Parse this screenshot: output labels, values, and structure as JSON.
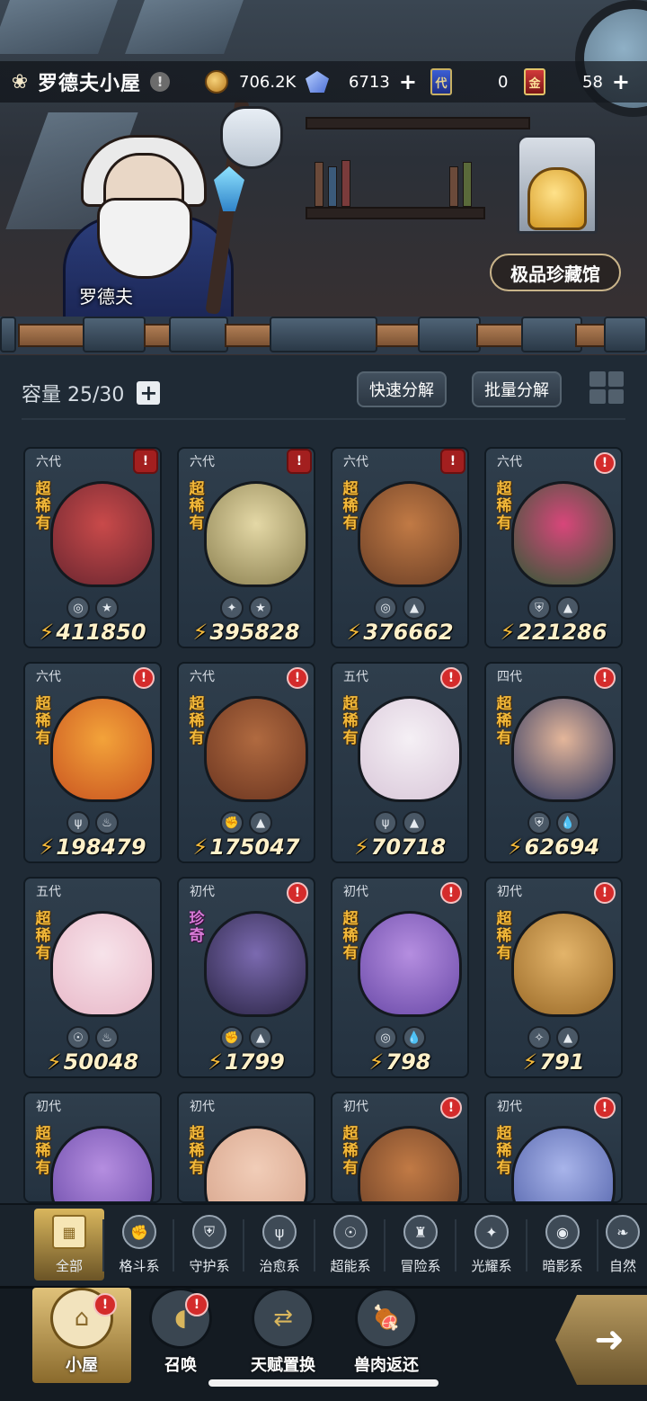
{
  "header": {
    "title": "罗德夫小屋",
    "info_icon": "info-icon"
  },
  "resources": {
    "gold": {
      "value": "706.2K",
      "icon": "gold-coin-icon"
    },
    "crystal": {
      "value": "6713",
      "icon": "crystal-icon"
    },
    "blue_ticket": {
      "value": "0",
      "icon": "blue-ticket-icon",
      "glyph": "代"
    },
    "red_ticket": {
      "value": "58",
      "icon": "red-ticket-icon",
      "glyph": "金"
    }
  },
  "scene": {
    "npc_name": "罗德夫",
    "vault_button": "极品珍藏馆"
  },
  "bag": {
    "capacity_label": "容量 25/30",
    "quick_decompose": "快速分解",
    "batch_decompose": "批量分解"
  },
  "cards": [
    {
      "gen": "六代",
      "rarity": "超稀有",
      "power": "411850",
      "alert": "boxed",
      "types": [
        "◎",
        "★"
      ],
      "art": [
        "#6a2630",
        "#c94a4a"
      ]
    },
    {
      "gen": "六代",
      "rarity": "超稀有",
      "power": "395828",
      "alert": "boxed",
      "types": [
        "✦",
        "★"
      ],
      "art": [
        "#8b8050",
        "#e4d8a6"
      ]
    },
    {
      "gen": "六代",
      "rarity": "超稀有",
      "power": "376662",
      "alert": "boxed",
      "types": [
        "◎",
        "▲"
      ],
      "art": [
        "#6b3f26",
        "#c17a45"
      ]
    },
    {
      "gen": "六代",
      "rarity": "超稀有",
      "power": "221286",
      "alert": "round",
      "types": [
        "⛨",
        "▲"
      ],
      "art": [
        "#2f5a35",
        "#d8467a"
      ]
    },
    {
      "gen": "六代",
      "rarity": "超稀有",
      "power": "198479",
      "alert": "round",
      "types": [
        "ψ",
        "♨"
      ],
      "art": [
        "#c95420",
        "#f3a33a"
      ]
    },
    {
      "gen": "六代",
      "rarity": "超稀有",
      "power": "175047",
      "alert": "round",
      "types": [
        "✊",
        "▲"
      ],
      "art": [
        "#6b3520",
        "#b06a40"
      ]
    },
    {
      "gen": "五代",
      "rarity": "超稀有",
      "power": "70718",
      "alert": "round",
      "types": [
        "ψ",
        "▲"
      ],
      "art": [
        "#d9c7d9",
        "#f5f0f5"
      ]
    },
    {
      "gen": "四代",
      "rarity": "超稀有",
      "power": "62694",
      "alert": "round",
      "types": [
        "⛨",
        "💧"
      ],
      "art": [
        "#2a3560",
        "#e4b69a"
      ]
    },
    {
      "gen": "五代",
      "rarity": "超稀有",
      "power": "50048",
      "alert": "none",
      "types": [
        "☉",
        "♨"
      ],
      "art": [
        "#e8b8c8",
        "#f7e3ea"
      ]
    },
    {
      "gen": "初代",
      "rarity": "珍奇",
      "power": "1799",
      "alert": "round",
      "types": [
        "✊",
        "▲"
      ],
      "art": [
        "#2b2545",
        "#7b6ab0"
      ]
    },
    {
      "gen": "初代",
      "rarity": "超稀有",
      "power": "798",
      "alert": "round",
      "types": [
        "◎",
        "💧"
      ],
      "art": [
        "#6a4aa8",
        "#b58ee0"
      ]
    },
    {
      "gen": "初代",
      "rarity": "超稀有",
      "power": "791",
      "alert": "round",
      "types": [
        "✧",
        "▲"
      ],
      "art": [
        "#9a6a28",
        "#e3b46a"
      ]
    },
    {
      "gen": "初代",
      "rarity": "超稀有",
      "power": "",
      "alert": "none",
      "types": [],
      "art": [
        "#6a4aa8",
        "#b58ee0"
      ]
    },
    {
      "gen": "初代",
      "rarity": "超稀有",
      "power": "",
      "alert": "none",
      "types": [],
      "art": [
        "#d6a38a",
        "#f1cdb8"
      ]
    },
    {
      "gen": "初代",
      "rarity": "超稀有",
      "power": "",
      "alert": "round",
      "types": [],
      "art": [
        "#6b3f26",
        "#c17a45"
      ]
    },
    {
      "gen": "初代",
      "rarity": "超稀有",
      "power": "",
      "alert": "round",
      "types": [],
      "art": [
        "#5060a8",
        "#a8b4ea"
      ]
    }
  ],
  "categories": [
    {
      "label": "全部",
      "icon": "all-category-icon",
      "glyph": "▦",
      "active": true
    },
    {
      "label": "格斗系",
      "icon": "fighting-fist-icon",
      "glyph": "✊",
      "active": false
    },
    {
      "label": "守护系",
      "icon": "guardian-shield-icon",
      "glyph": "⛨",
      "active": false
    },
    {
      "label": "治愈系",
      "icon": "healing-sprout-icon",
      "glyph": "ψ",
      "active": false
    },
    {
      "label": "超能系",
      "icon": "psychic-alien-icon",
      "glyph": "☉",
      "active": false
    },
    {
      "label": "冒险系",
      "icon": "adventure-tower-icon",
      "glyph": "♜",
      "active": false
    },
    {
      "label": "光耀系",
      "icon": "radiance-star-icon",
      "glyph": "✦",
      "active": false
    },
    {
      "label": "暗影系",
      "icon": "shadow-eye-icon",
      "glyph": "◉",
      "active": false
    },
    {
      "label": "自然",
      "icon": "nature-leaf-icon",
      "glyph": "❧",
      "active": false
    }
  ],
  "nav": [
    {
      "label": "小屋",
      "icon": "cabin-icon",
      "glyph": "⌂",
      "alert": true,
      "active": true
    },
    {
      "label": "召唤",
      "icon": "summon-egg-icon",
      "glyph": "◖",
      "alert": true,
      "active": false
    },
    {
      "label": "天赋置换",
      "icon": "talent-swap-icon",
      "glyph": "⇄",
      "alert": false,
      "active": false
    },
    {
      "label": "兽肉返还",
      "icon": "meat-return-icon",
      "glyph": "🍖",
      "alert": false,
      "active": false
    }
  ],
  "go_button": "➜",
  "alert_glyph": "!"
}
